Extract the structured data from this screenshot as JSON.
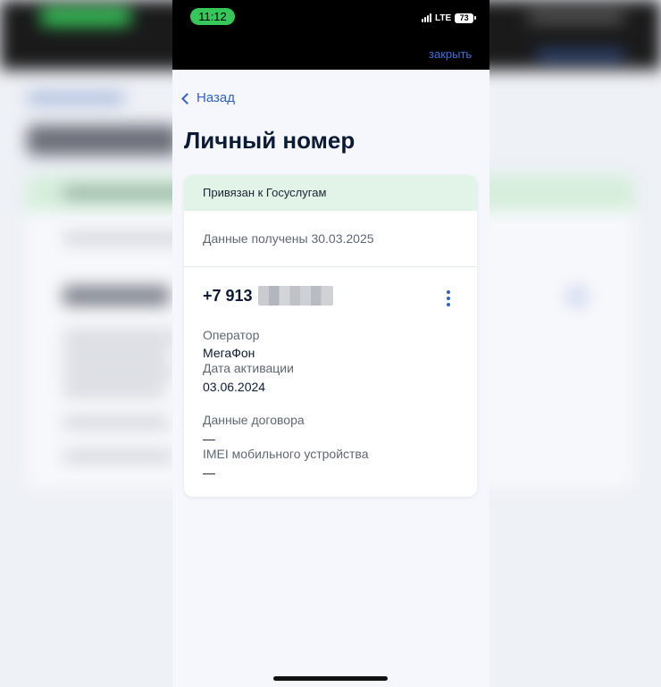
{
  "status_bar": {
    "time": "11:12",
    "network": "LTE",
    "battery": "73"
  },
  "header": {
    "close_label": "закрыть"
  },
  "nav": {
    "back_label": "Назад"
  },
  "page": {
    "title": "Личный номер"
  },
  "card": {
    "badge": "Привязан к Госуслугам",
    "received": "Данные получены 30.03.2025",
    "phone_prefix": "+7 913",
    "operator_label": "Оператор",
    "operator_value": "МегаФон",
    "activation_label": "Дата активации",
    "activation_value": "03.06.2024",
    "contract_label": "Данные договора",
    "contract_value": "—",
    "imei_label": "IMEI мобильного устройства",
    "imei_value": "—"
  },
  "colors": {
    "accent": "#2e62c9",
    "badge_bg": "#e2f3e7",
    "time_pill": "#35c759"
  }
}
